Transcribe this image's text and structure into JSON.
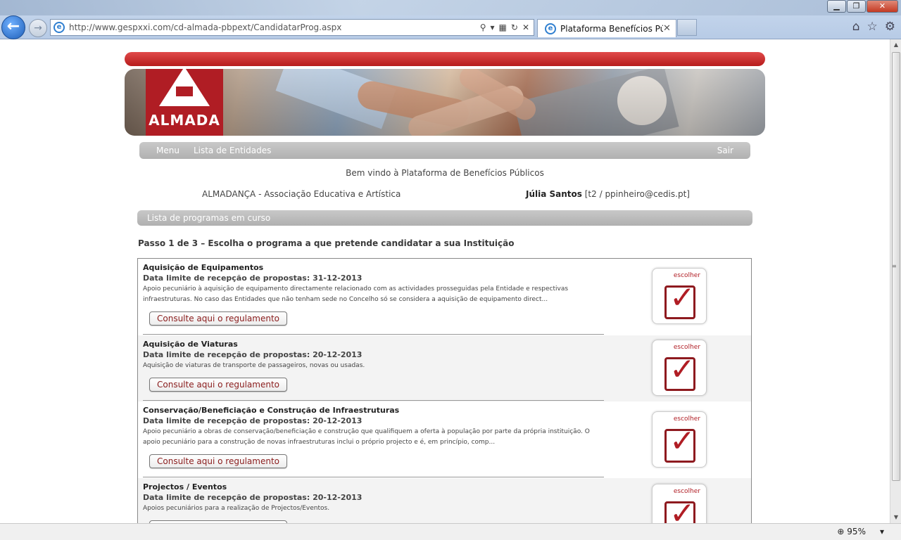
{
  "browser": {
    "url": "http://www.gespxxi.com/cd-almada-pbpext/CandidatarProg.aspx",
    "tab_title": "Plataforma Benefícios Públi...",
    "zoom": "95%"
  },
  "site": {
    "logo_text": "ALMADA",
    "nav": {
      "menu": "Menu",
      "entities": "Lista de Entidades",
      "logout": "Sair"
    },
    "welcome": "Bem vindo à Plataforma de Benefícios Públicos",
    "entity": "ALMADANÇA - Associação Educativa e Artística",
    "user_name": "Júlia Santos",
    "user_details": "[t2 / ppinheiro@cedis.pt]",
    "section_title": "Lista de programas em curso",
    "step": "Passo 1 de 3 – Escolha o programa a que pretende candidatar a sua Instituição",
    "choose_label": "escolher",
    "reg_button": "Consulte aqui o regulamento"
  },
  "programs": [
    {
      "name": "Aquisição de Equipamentos",
      "date": "Data limite de recepção de propostas: 31-12-2013",
      "desc": "Apoio pecuniário à aquisição de equipamento directamente relacionado com as actividades prosseguidas pela Entidade e respectivas infraestruturas. No caso das Entidades que não tenham sede no Concelho só se considera a aquisição de equipamento direct..."
    },
    {
      "name": "Aquisição de Viaturas",
      "date": "Data limite de recepção de propostas: 20-12-2013",
      "desc": "Aquisição de viaturas de transporte de passageiros, novas ou usadas."
    },
    {
      "name": "Conservação/Beneficiação e Construção de Infraestruturas",
      "date": "Data limite de recepção de propostas: 20-12-2013",
      "desc": "Apoio pecuniário a obras de conservação/beneficiação e construção que qualifiquem a oferta à população por parte da própria instituição. O apoio pecuniário para a construção de novas infraestruturas inclui o próprio projecto e é, em princípio, comp..."
    },
    {
      "name": "Projectos / Eventos",
      "date": "Data limite de recepção de propostas: 20-12-2013",
      "desc": "Apoios pecuniários para a realização de Projectos/Eventos."
    }
  ]
}
